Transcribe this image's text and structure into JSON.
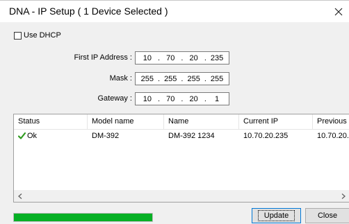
{
  "window": {
    "title": "DNA - IP Setup ( 1 Device Selected )",
    "close_glyph": "close-icon"
  },
  "dhcp": {
    "label": "Use DHCP",
    "checked": false
  },
  "form": {
    "first_ip": {
      "label": "First IP Address :",
      "segments": [
        "10",
        "70",
        "20",
        "235"
      ]
    },
    "mask": {
      "label": "Mask :",
      "segments": [
        "255",
        "255",
        "255",
        "255"
      ]
    },
    "gateway": {
      "label": "Gateway :",
      "segments": [
        "10",
        "70",
        "20",
        "1"
      ]
    }
  },
  "list": {
    "columns": [
      "Status",
      "Model name",
      "Name",
      "Current IP",
      "Previous I"
    ],
    "rows": [
      {
        "status": "Ok",
        "model": "DM-392",
        "name": "DM-392 1234",
        "current_ip": "10.70.20.235",
        "previous_ip": "10.70.20."
      }
    ],
    "status_icon": "check-icon",
    "status_color": "#2e9a1e"
  },
  "progress": {
    "fraction": 1.0,
    "color": "#06b025"
  },
  "buttons": {
    "update": "Update",
    "close": "Close"
  }
}
